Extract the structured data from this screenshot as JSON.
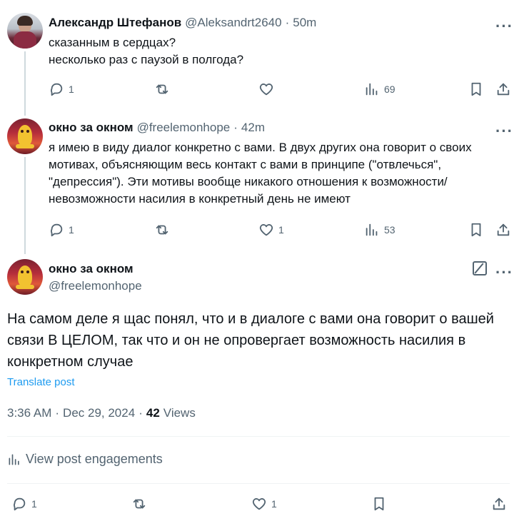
{
  "replies": [
    {
      "name": "Александр Штефанов",
      "handle": "@Aleksandrt2640",
      "time": "50m",
      "text": "сказанным в сердцах?\nнесколько раз с паузой в полгода?",
      "replies": "1",
      "likes": "",
      "views": "69"
    },
    {
      "name": "окно за окном",
      "handle": "@freelemonhope",
      "time": "42m",
      "text": "я имею в виду диалог конкретно с вами. В двух других она говорит о своих\nмотивах, объясняющим весь контакт с вами в принципе  (\"отвлечься\",\n\"депрессия\"). Эти мотивы вообще никакого отношения к возможности/\nневозможности насилия в конкретный день не имеют",
      "replies": "1",
      "likes": "1",
      "views": "53"
    }
  ],
  "main": {
    "name": "окно за окном",
    "handle": "@freelemonhope",
    "text": "На самом деле я щас понял, что и в диалоге с вами она говорит о вашей\nсвязи В ЦЕЛОМ, так что и он не опровергает возможность насилия в\nконкретном случае",
    "translate": "Translate post",
    "time": "3:36 AM",
    "date": "Dec 29, 2024",
    "views_count": "42",
    "views_label": "Views",
    "engagements": "View post engagements",
    "replies": "1",
    "likes": "1"
  },
  "separator": "·",
  "more": "···",
  "colors": {
    "accent": "#1d9bf0",
    "muted": "#536471",
    "divider": "#eff3f4"
  }
}
